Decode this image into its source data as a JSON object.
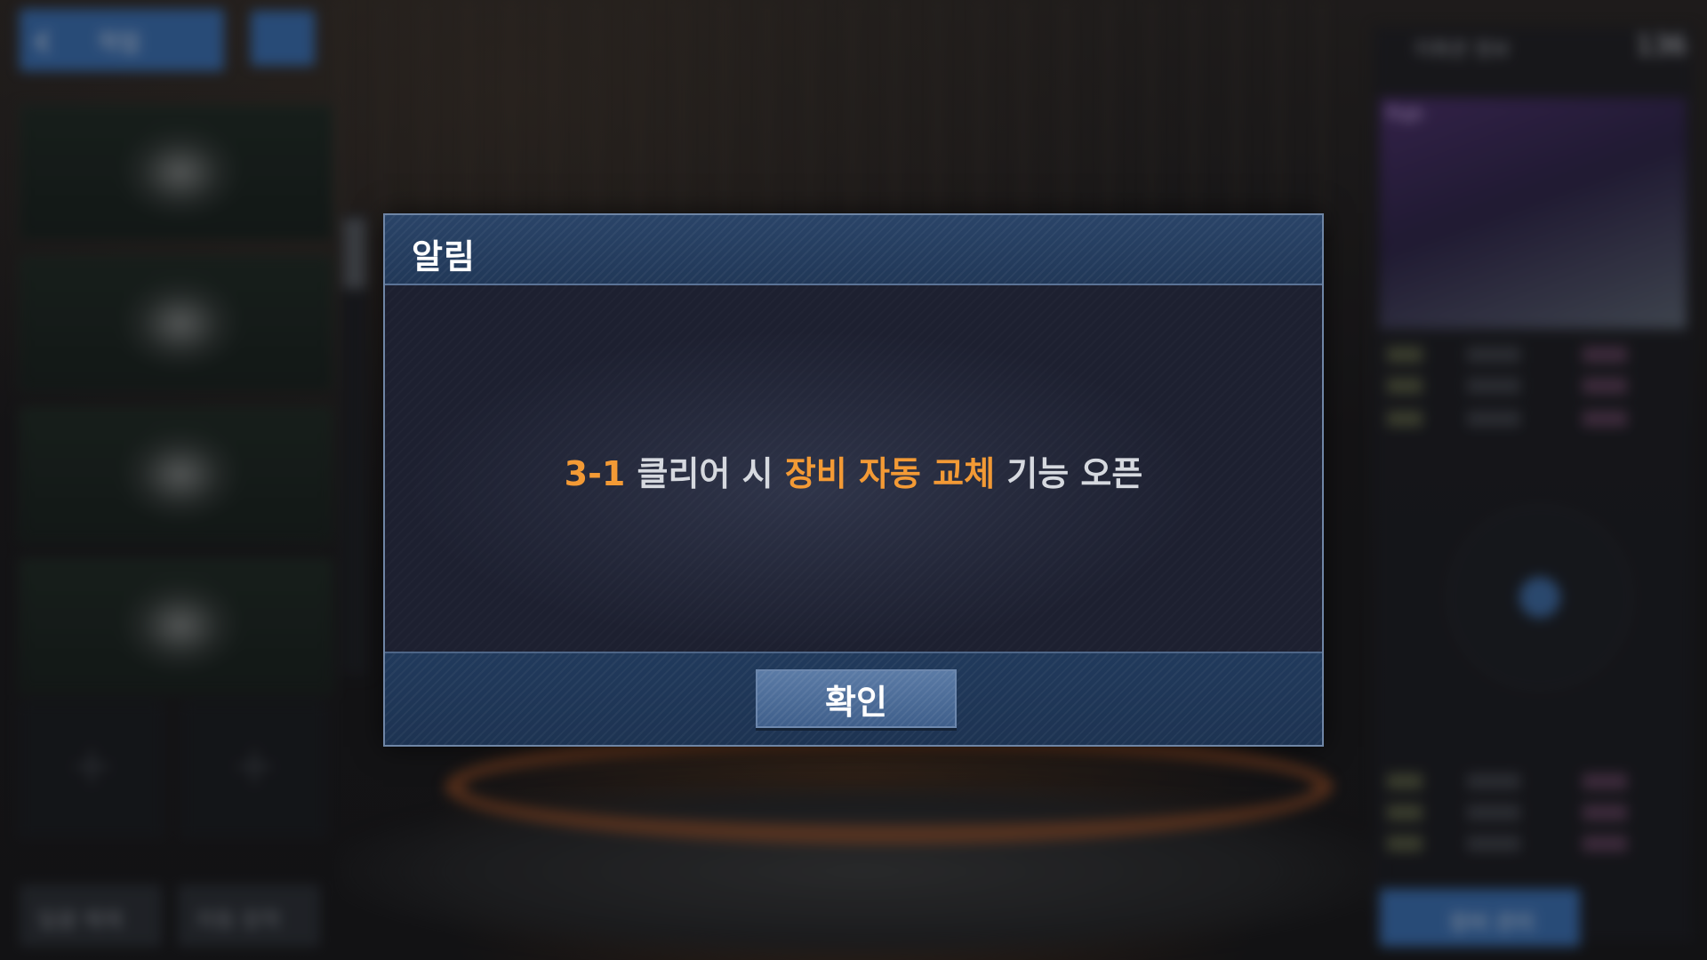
{
  "background": {
    "back_label": "작업",
    "right_title": "지휘관 정보",
    "right_level": "136",
    "portrait_tag": "Fiqh",
    "left_bottom_button_1": "일괄 해제",
    "left_bottom_button_2": "자동 장착",
    "right_bottom_button": "장비 관리"
  },
  "dialog": {
    "title": "알림",
    "message": {
      "part1": "3-1",
      "part2": " 클리어 시 ",
      "part3": "장비 자동 교체",
      "part4": " 기능 오픈"
    },
    "confirm_label": "확인"
  },
  "colors": {
    "highlight": "#f39a35",
    "message_text": "#d6d9df",
    "header_bg": "#2a4468",
    "button_bg": "#4d6d98"
  }
}
